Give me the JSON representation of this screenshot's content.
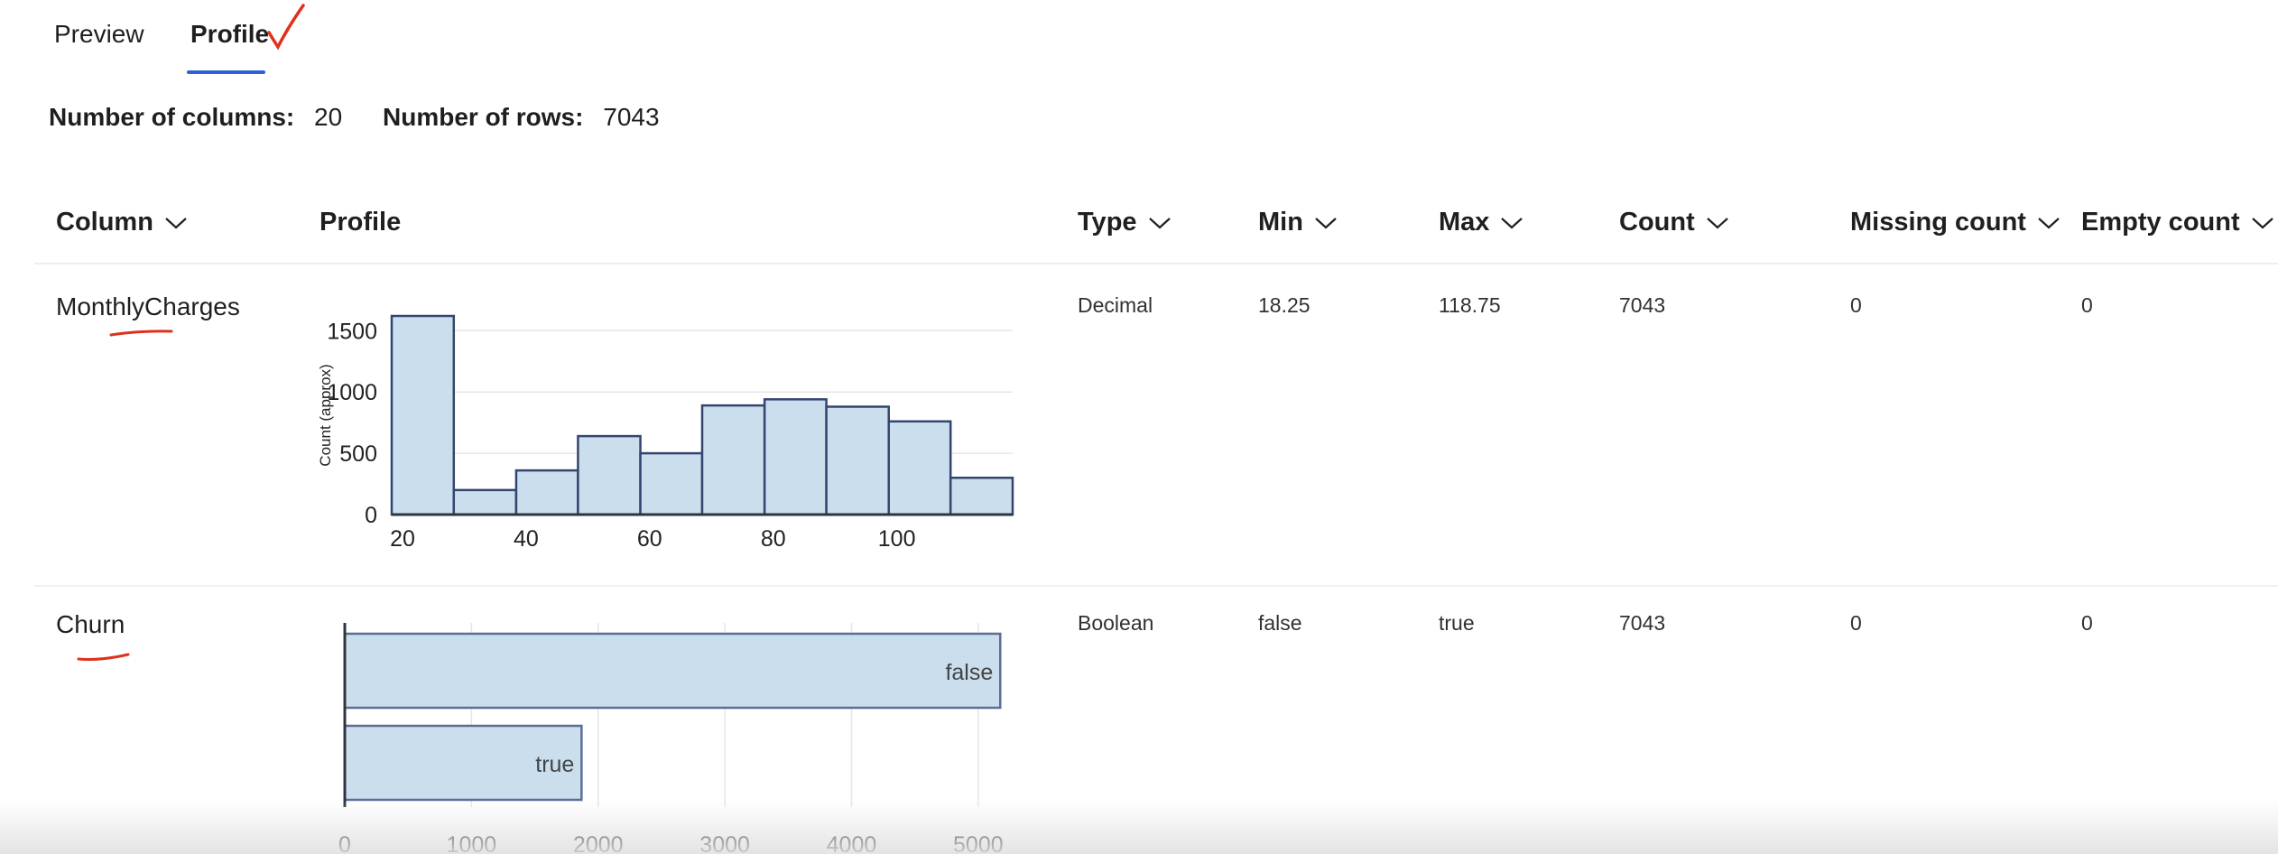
{
  "tabs": [
    {
      "label": "Preview",
      "selected": false
    },
    {
      "label": "Profile",
      "selected": true
    }
  ],
  "summary": {
    "columns_label": "Number of columns:",
    "columns_value": "20",
    "rows_label": "Number of rows:",
    "rows_value": "7043"
  },
  "table_headers": {
    "column": "Column",
    "profile": "Profile",
    "type": "Type",
    "min": "Min",
    "max": "Max",
    "count": "Count",
    "missing": "Missing count",
    "empty": "Empty count"
  },
  "rows": [
    {
      "name": "MonthlyCharges",
      "type": "Decimal",
      "min": "18.25",
      "max": "118.75",
      "count": "7043",
      "missing": "0",
      "empty": "0"
    },
    {
      "name": "Churn",
      "type": "Boolean",
      "min": "false",
      "max": "true",
      "count": "7043",
      "missing": "0",
      "empty": "0"
    }
  ],
  "colors": {
    "accent": "#2b63d4",
    "annotation": "#e0301e",
    "bar_fill": "#cadeed",
    "bar_stroke": "#34466f"
  },
  "chart_data": [
    {
      "type": "bar",
      "subtype": "histogram",
      "ylabel": "Count (approx)",
      "x_ticks": [
        "20",
        "40",
        "60",
        "80",
        "100"
      ],
      "y_ticks": [
        "0",
        "500",
        "1000",
        "1500"
      ],
      "bins": [
        {
          "x0": 18.25,
          "x1": 28.3,
          "value": 1620
        },
        {
          "x0": 28.3,
          "x1": 38.4,
          "value": 200
        },
        {
          "x0": 38.4,
          "x1": 48.4,
          "value": 360
        },
        {
          "x0": 48.4,
          "x1": 58.5,
          "value": 640
        },
        {
          "x0": 58.5,
          "x1": 68.5,
          "value": 500
        },
        {
          "x0": 68.5,
          "x1": 78.6,
          "value": 890
        },
        {
          "x0": 78.6,
          "x1": 88.6,
          "value": 940
        },
        {
          "x0": 88.6,
          "x1": 98.7,
          "value": 880
        },
        {
          "x0": 98.7,
          "x1": 108.7,
          "value": 760
        },
        {
          "x0": 108.7,
          "x1": 118.75,
          "value": 300
        }
      ],
      "xlim": [
        18.25,
        118.75
      ],
      "ylim": [
        0,
        1620
      ],
      "grid": true
    },
    {
      "type": "bar",
      "orientation": "horizontal",
      "categories": [
        "false",
        "true"
      ],
      "values": [
        5174,
        1869
      ],
      "x_ticks": [
        "0",
        "1000",
        "2000",
        "3000",
        "4000",
        "5000"
      ],
      "xlim": [
        0,
        5400
      ],
      "grid": true
    }
  ]
}
